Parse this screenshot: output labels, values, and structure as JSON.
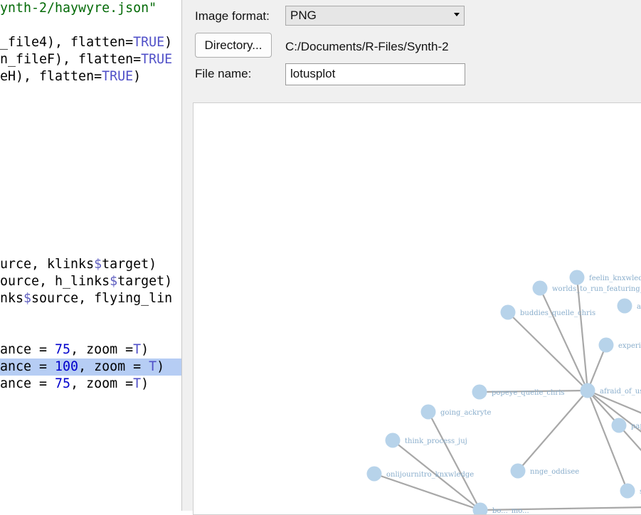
{
  "editor": {
    "lines": [
      [
        {
          "t": "ynth-2/haywyre.json\"",
          "c": "str"
        }
      ],
      [
        {
          "t": "_file4), flatten="
        },
        {
          "t": "TRUE",
          "c": "kw"
        },
        {
          "t": ")"
        }
      ],
      [
        {
          "t": "n_fileF), flatten="
        },
        {
          "t": "TRUE",
          "c": "kw"
        }
      ],
      [
        {
          "t": "eH), flatten="
        },
        {
          "t": "TRUE",
          "c": "kw"
        },
        {
          "t": ")"
        }
      ],
      [
        {
          "t": "urce, klinks"
        },
        {
          "t": "$",
          "c": "op"
        },
        {
          "t": "target)"
        }
      ],
      [
        {
          "t": "ource, h_links"
        },
        {
          "t": "$",
          "c": "op"
        },
        {
          "t": "target)"
        }
      ],
      [
        {
          "t": "nks"
        },
        {
          "t": "$",
          "c": "op"
        },
        {
          "t": "source, flying_lin"
        }
      ],
      [
        {
          "t": "ance = "
        },
        {
          "t": "75",
          "c": "num"
        },
        {
          "t": ", zoom ="
        },
        {
          "t": "T",
          "c": "kw"
        },
        {
          "t": ")"
        }
      ],
      [
        {
          "t": "ance = "
        },
        {
          "t": "100",
          "c": "num"
        },
        {
          "t": ", zoom = "
        },
        {
          "t": "T",
          "c": "kw"
        },
        {
          "t": ")"
        }
      ],
      [
        {
          "t": "ance = "
        },
        {
          "t": "75",
          "c": "num"
        },
        {
          "t": ", zoom ="
        },
        {
          "t": "T",
          "c": "kw"
        },
        {
          "t": ")"
        }
      ]
    ]
  },
  "dialog": {
    "image_format_label": "Image format:",
    "image_format_value": "PNG",
    "directory_button": "Directory...",
    "directory_path": "C:/Documents/R-Files/Synth-2",
    "file_name_label": "File name:",
    "file_name_value": "lotusplot"
  },
  "plot": {
    "node_color": "#b7d3ea",
    "edge_color": "#a8a8a8",
    "label_color": "#8aaecc",
    "nodes": [
      {
        "id": "afraid",
        "label": "afraid_of_us"
      },
      {
        "id": "feelin",
        "label": "feelin_knxwledge"
      },
      {
        "id": "worlds",
        "label": "worlds_to_run_featuring_m"
      },
      {
        "id": "buddies",
        "label": "buddies_quelle_chris"
      },
      {
        "id": "a_",
        "label": "a_"
      },
      {
        "id": "experi",
        "label": "experie"
      },
      {
        "id": "popeye",
        "label": "popeye_quelle_chris"
      },
      {
        "id": "going",
        "label": "going_ackryte"
      },
      {
        "id": "pap",
        "label": "pap"
      },
      {
        "id": "think",
        "label": "think_process_juj"
      },
      {
        "id": "onli",
        "label": "onlijournitro_knxwledge"
      },
      {
        "id": "nnge",
        "label": "nnge_oddisee"
      },
      {
        "id": "bottom",
        "label": "bo..._mo..."
      },
      {
        "id": "rightlow",
        "label": "s"
      }
    ]
  }
}
